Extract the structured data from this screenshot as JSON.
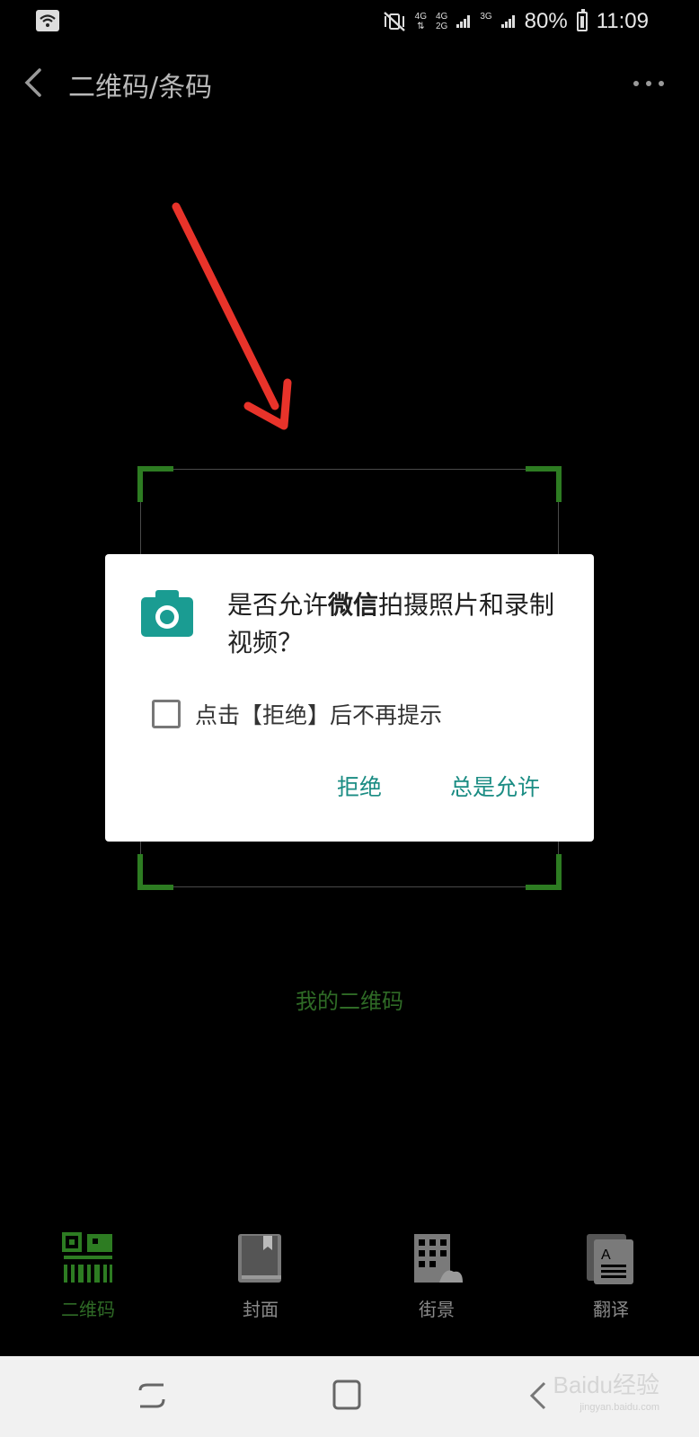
{
  "status_bar": {
    "network_1": "4G",
    "network_2_top": "4G",
    "network_2_bottom": "2G",
    "network_3": "3G",
    "battery": "80%",
    "time": "11:09"
  },
  "app_bar": {
    "title": "二维码/条码"
  },
  "scanner": {
    "my_qr_link": "我的二维码"
  },
  "dialog": {
    "title_prefix": "是否允许",
    "title_app": "微信",
    "title_suffix": "拍摄照片和录制视频？",
    "checkbox_label": "点击【拒绝】后不再提示",
    "deny_label": "拒绝",
    "allow_label": "总是允许"
  },
  "bottom_nav": {
    "items": [
      {
        "label": "二维码",
        "icon": "qr-code-icon"
      },
      {
        "label": "封面",
        "icon": "book-cover-icon"
      },
      {
        "label": "街景",
        "icon": "street-view-icon"
      },
      {
        "label": "翻译",
        "icon": "translate-icon"
      }
    ]
  },
  "watermark": {
    "brand": "Baidu经验",
    "url": "jingyan.baidu.com"
  },
  "colors": {
    "accent_green": "#2d7c22",
    "dialog_button": "#1a8c83",
    "annotation_arrow": "#e8332a"
  }
}
